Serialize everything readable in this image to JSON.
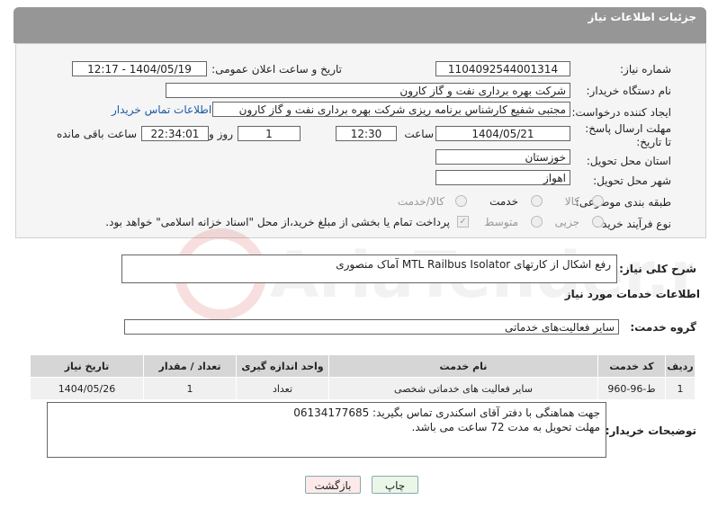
{
  "header": {
    "title": "جزئیات اطلاعات نیاز"
  },
  "form": {
    "need_number_label": "شماره نیاز:",
    "need_number": "1104092544001314",
    "announce_label": "تاریخ و ساعت اعلان عمومی:",
    "announce_value": "1404/05/19 - 12:17",
    "buyer_org_label": "نام دستگاه خریدار:",
    "buyer_org": "شرکت بهره برداری نفت و گاز کارون",
    "creator_label": "ایجاد کننده درخواست:",
    "creator": "مجتبی شفیع کارشناس برنامه ریزی شرکت بهره برداری نفت و گاز کارون",
    "buyer_contact_link": "اطلاعات تماس خریدار",
    "deadline_label": "مهلت ارسال پاسخ: تا تاریخ:",
    "deadline_date": "1404/05/21",
    "time_label": "ساعت",
    "deadline_time": "12:30",
    "days_value": "1",
    "days_label": "روز و",
    "remaining_time": "22:34:01",
    "remaining_label": "ساعت باقی مانده",
    "province_label": "استان محل تحویل:",
    "province": "خوزستان",
    "city_label": "شهر محل تحویل:",
    "city": "اهواز",
    "category_label": "طبقه بندی موضوعی:",
    "category_options": [
      "کالا",
      "خدمت",
      "کالا/خدمت"
    ],
    "process_label": "نوع فرآیند خرید :",
    "process_options": [
      "جزیی",
      "متوسط"
    ],
    "payment_note": "پرداخت تمام یا بخشی از مبلغ خرید،از محل \"اسناد خزانه اسلامی\" خواهد بود."
  },
  "summary": {
    "label": "شرح کلی نیاز:",
    "text": "رفع اشکال از کارتهای MTL Railbus Isolator آماک منصوری"
  },
  "services": {
    "section_title": "اطلاعات خدمات مورد نیاز",
    "group_label": "گروه خدمت:",
    "group_value": "سایر فعالیت‌های خدماتی",
    "table": {
      "headers": [
        "ردیف",
        "کد خدمت",
        "نام خدمت",
        "واحد اندازه گیری",
        "تعداد / مقدار",
        "تاریخ نیاز"
      ],
      "rows": [
        [
          "1",
          "ط-96-960",
          "سایر فعالیت های خدماتی شخصی",
          "تعداد",
          "1",
          "1404/05/26"
        ]
      ]
    }
  },
  "buyer_notes": {
    "label": "توضیحات خریدار:",
    "line1": "جهت هماهنگی با دفتر آقای اسکندری تماس بگیرید: 06134177685",
    "line2": "مهلت تحویل به مدت 72 ساعت می باشد."
  },
  "buttons": {
    "print": "چاپ",
    "back": "بازگشت"
  },
  "watermark_text": "AriaTender.neT",
  "colors": {
    "header_bg": "#969696",
    "link": "#1a5aa8",
    "back_btn_bg": "#fde9e9",
    "print_btn_bg": "#eaf7e8"
  }
}
